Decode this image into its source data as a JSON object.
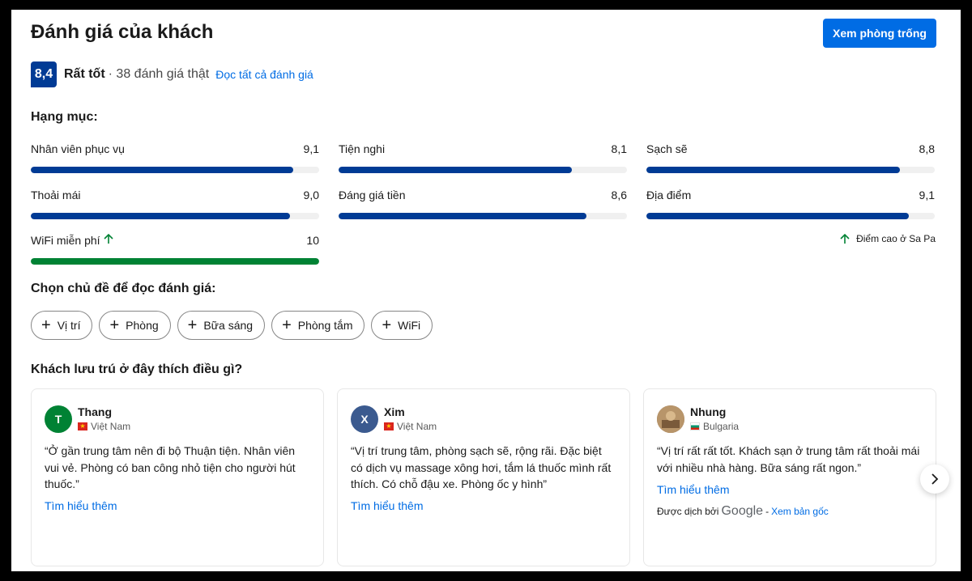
{
  "header": {
    "title": "Đánh giá của khách",
    "cta_label": "Xem phòng trống"
  },
  "summary": {
    "score": "8,4",
    "label": "Rất tốt",
    "count_text": "· 38 đánh giá thật",
    "read_all": "Đọc tất cả đánh giá"
  },
  "categories_heading": "Hạng mục:",
  "categories": [
    {
      "name": "Nhân viên phục vụ",
      "score": "9,1",
      "value": 9.1
    },
    {
      "name": "Tiện nghi",
      "score": "8,1",
      "value": 8.1
    },
    {
      "name": "Sạch sẽ",
      "score": "8,8",
      "value": 8.8
    },
    {
      "name": "Thoải mái",
      "score": "9,0",
      "value": 9.0
    },
    {
      "name": "Đáng giá tiền",
      "score": "8,6",
      "value": 8.6
    },
    {
      "name": "Địa điểm",
      "score": "9,1",
      "value": 9.1
    },
    {
      "name": "WiFi miễn phí",
      "score": "10",
      "value": 10,
      "highlight": true
    }
  ],
  "high_score_note": "Điểm cao ở Sa Pa",
  "colors": {
    "accent": "#006ce4",
    "badge": "#003b95",
    "bar": "#003b95",
    "bar_high": "#008234"
  },
  "topics_heading": "Chọn chủ đề để đọc đánh giá:",
  "topics": [
    "Vị trí",
    "Phòng",
    "Bữa sáng",
    "Phòng tắm",
    "WiFi"
  ],
  "liked_heading": "Khách lưu trú ở đây thích điều gì?",
  "reviews": [
    {
      "initial": "T",
      "avatar_color": "#008234",
      "name": "Thang",
      "country": "Việt Nam",
      "flag": "vn",
      "quote": "“Ở gần trung tâm nên đi bộ Thuận tiện. Nhân viên vui vẻ. Phòng có ban công nhỏ tiện cho người hút thuốc.”",
      "more": "Tìm hiểu thêm"
    },
    {
      "initial": "X",
      "avatar_color": "#3b5a8f",
      "name": "Xim",
      "country": "Việt Nam",
      "flag": "vn",
      "quote": "“Vị trí trung tâm, phòng sạch sẽ, rộng rãi. Đặc biệt có dịch vụ massage xông hơi, tắm lá thuốc mình rất thích. Có chỗ đậu xe. Phòng ốc y hình”",
      "more": "Tìm hiểu thêm"
    },
    {
      "initial": "",
      "avatar_color": "#8a6a4a",
      "name": "Nhung",
      "country": "Bulgaria",
      "flag": "bg",
      "quote": "“Vị trí rất rất tốt. Khách sạn ở trung tâm rất thoải mái với nhiều nhà hàng. Bữa sáng rất ngon.”",
      "more": "Tìm hiểu thêm",
      "translated_by": "Được dịch bởi",
      "google": "Google",
      "see_original": "Xem bản gốc"
    }
  ]
}
